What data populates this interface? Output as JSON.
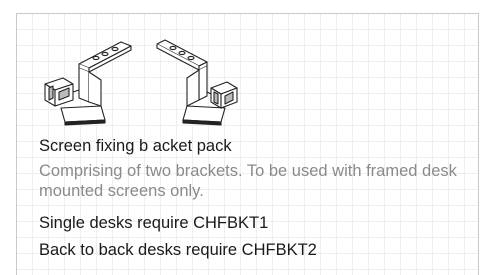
{
  "product": {
    "image_icon": "bracket-pair-illustration",
    "title": "Screen fixing b acket pack",
    "description": "Comprising of two brackets. To be used with framed desk mounted screens only.",
    "requirements": [
      "Single desks require CHFBKT1",
      "Back to back desks require CHFBKT2"
    ]
  },
  "colors": {
    "text_primary": "#1a1a1a",
    "text_secondary": "#8a8a8a",
    "border": "#c9c9c9",
    "grid": "#eeeeee"
  }
}
